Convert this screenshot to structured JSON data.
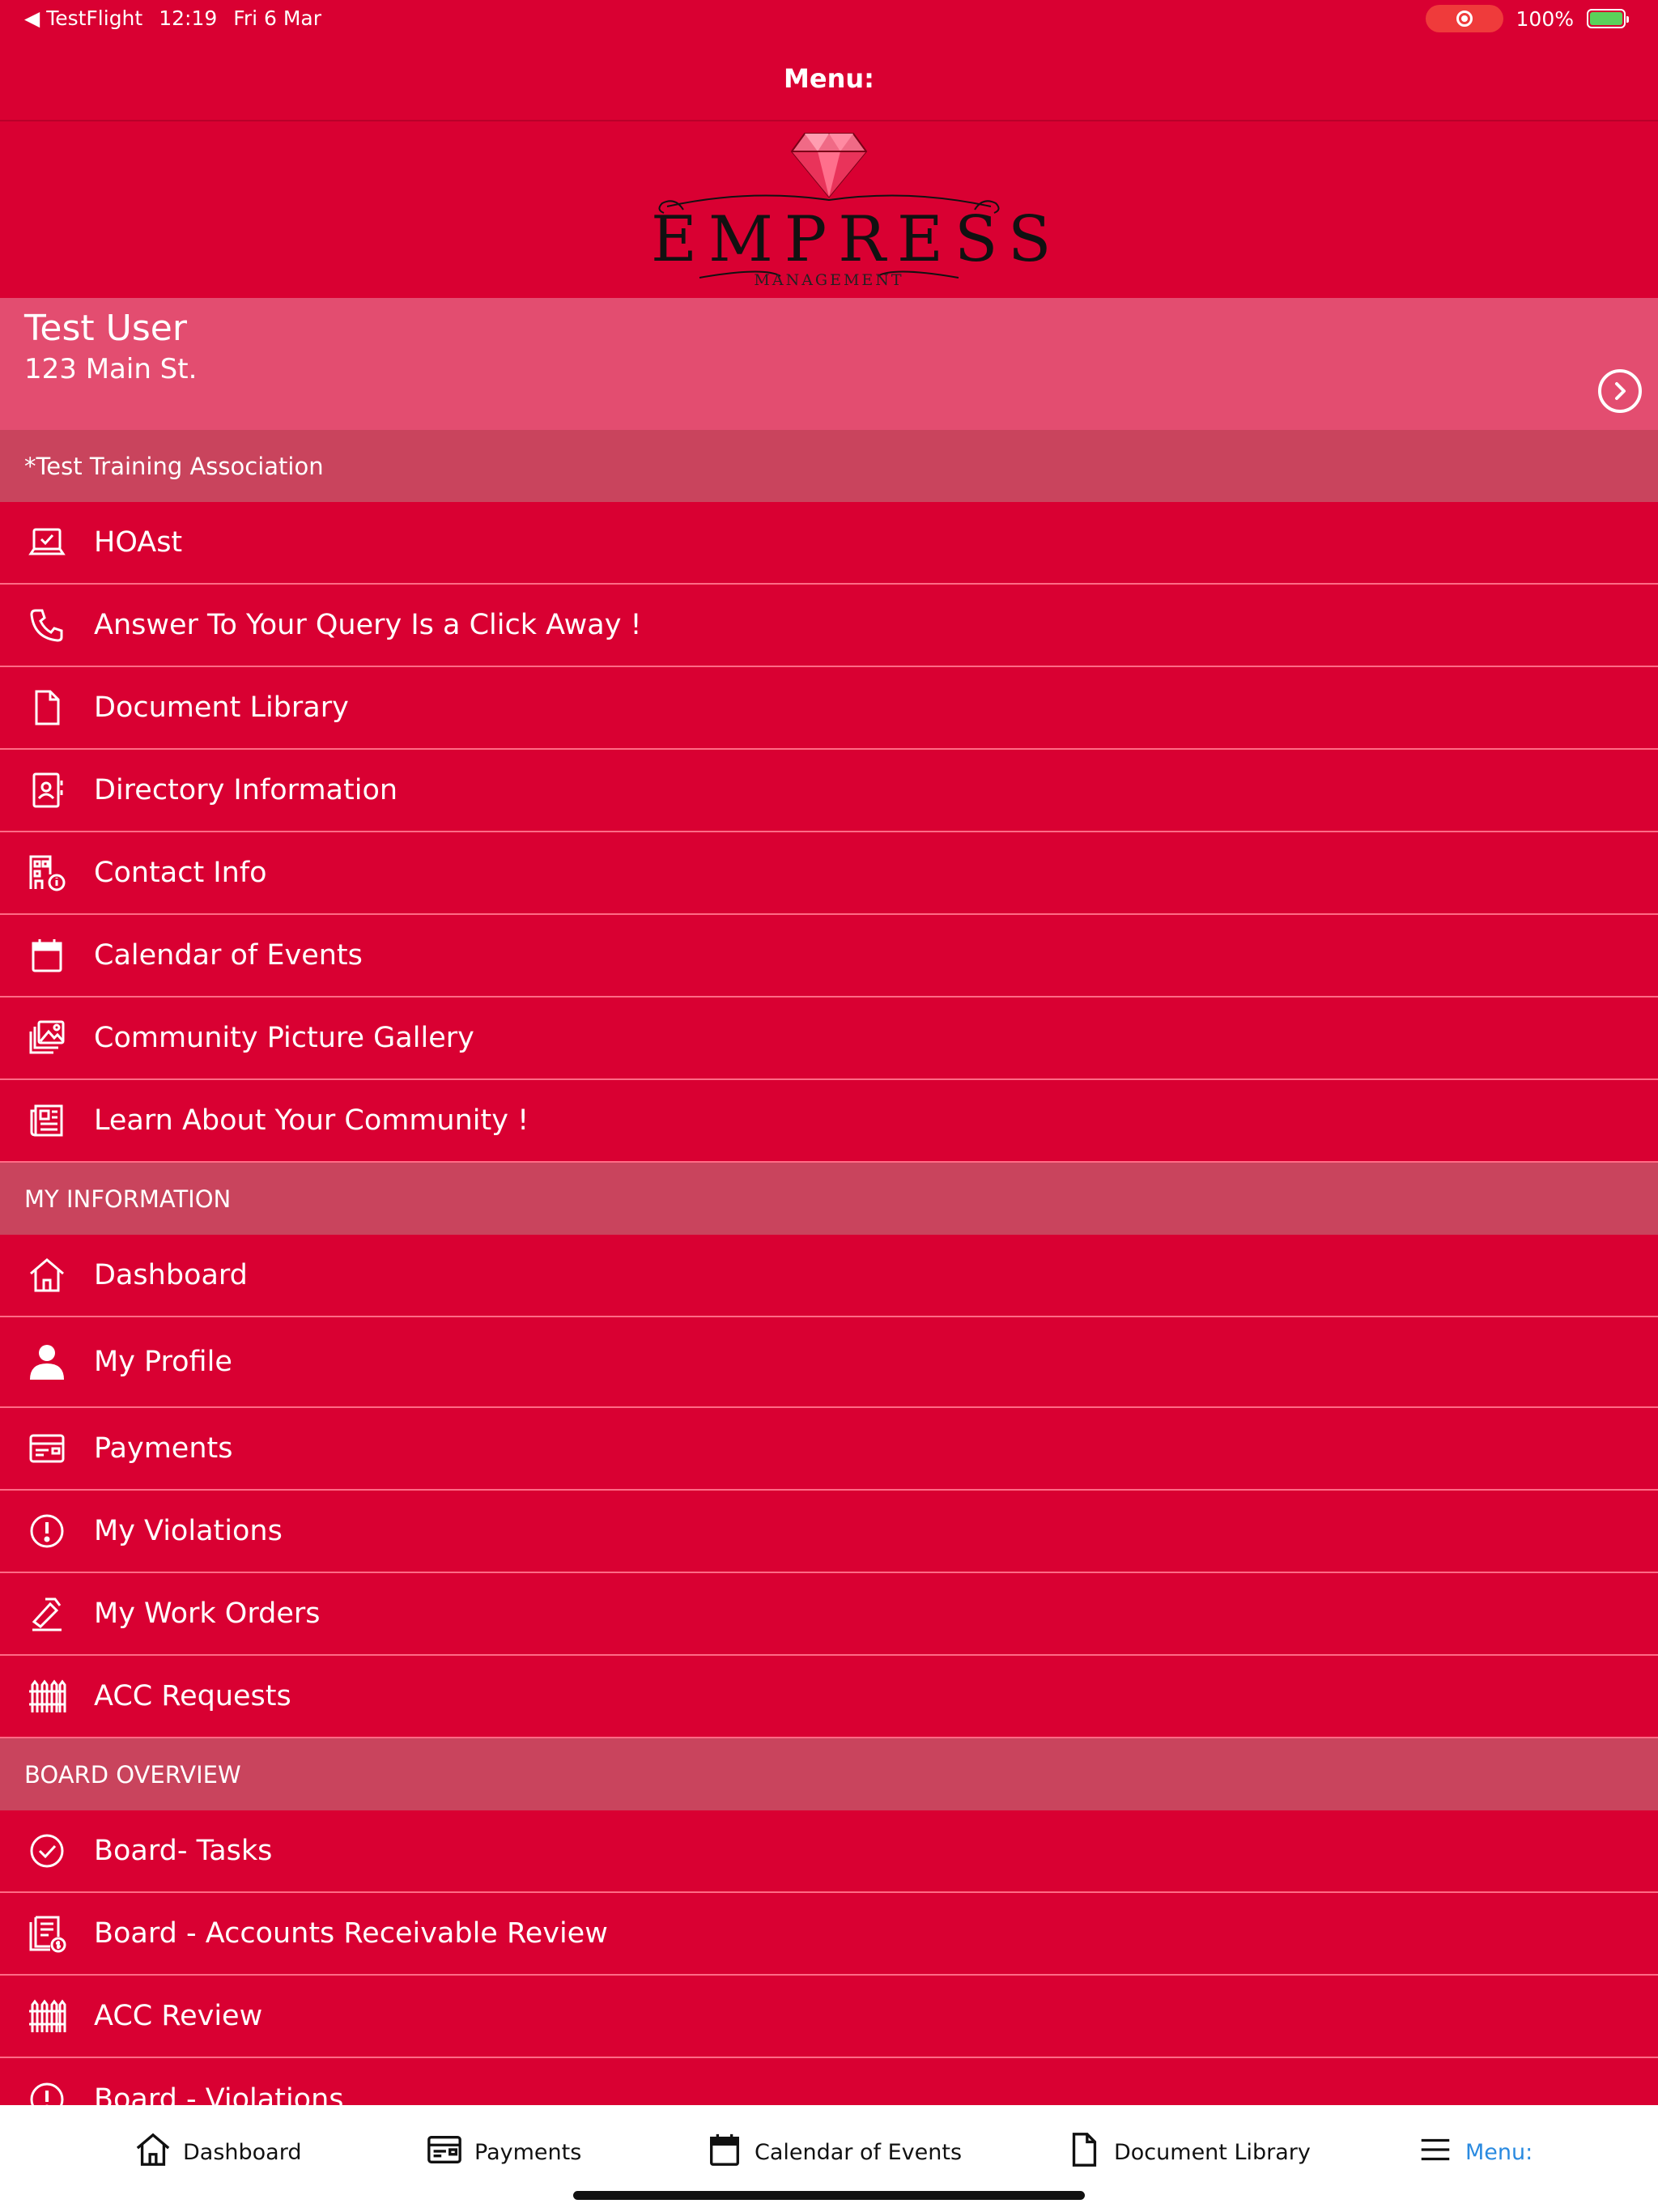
{
  "status_bar": {
    "back_app": "TestFlight",
    "time": "12:19",
    "date": "Fri 6 Mar",
    "battery": "100%"
  },
  "nav": {
    "title": "Menu:"
  },
  "logo": {
    "word": "EMPRESS",
    "sub": "MANAGEMENT"
  },
  "user": {
    "name": "Test User",
    "address": "123 Main St."
  },
  "sections": {
    "association": "*Test Training Association",
    "my_information": "MY INFORMATION",
    "board_overview": "BOARD OVERVIEW"
  },
  "association_items": [
    {
      "label": "HOAst",
      "icon": "laptop-check-icon"
    },
    {
      "label": "Answer To Your Query Is a Click Away !",
      "icon": "phone-icon"
    },
    {
      "label": "Document Library",
      "icon": "document-icon"
    },
    {
      "label": "Directory Information",
      "icon": "contact-book-icon"
    },
    {
      "label": "Contact Info",
      "icon": "building-info-icon"
    },
    {
      "label": "Calendar of Events",
      "icon": "calendar-icon"
    },
    {
      "label": "Community Picture Gallery",
      "icon": "gallery-icon"
    },
    {
      "label": "Learn About Your Community !",
      "icon": "newspaper-icon"
    }
  ],
  "my_info_items": [
    {
      "label": "Dashboard",
      "icon": "home-icon"
    },
    {
      "label": "My Profile",
      "icon": "person-icon"
    },
    {
      "label": "Payments",
      "icon": "payment-card-icon"
    },
    {
      "label": "My Violations",
      "icon": "alert-circle-icon"
    },
    {
      "label": "My Work Orders",
      "icon": "tools-icon"
    },
    {
      "label": "ACC Requests",
      "icon": "fence-icon"
    }
  ],
  "board_items": [
    {
      "label": "Board- Tasks",
      "icon": "check-circle-icon"
    },
    {
      "label": "Board - Accounts Receivable Review",
      "icon": "receivable-icon"
    },
    {
      "label": "ACC Review",
      "icon": "fence-icon"
    },
    {
      "label": "Board - Violations",
      "icon": "alert-circle-icon"
    }
  ],
  "tabs": [
    {
      "label": "Dashboard",
      "icon": "home-icon"
    },
    {
      "label": "Payments",
      "icon": "payment-card-icon"
    },
    {
      "label": "Calendar of Events",
      "icon": "calendar-icon"
    },
    {
      "label": "Document Library",
      "icon": "document-icon"
    },
    {
      "label": "Menu:",
      "icon": "menu-icon"
    }
  ],
  "colors": {
    "background": "#d90032",
    "user_panel": "#e34d70",
    "section_header": "#c9445d",
    "active_tab": "#2a8ae0"
  }
}
